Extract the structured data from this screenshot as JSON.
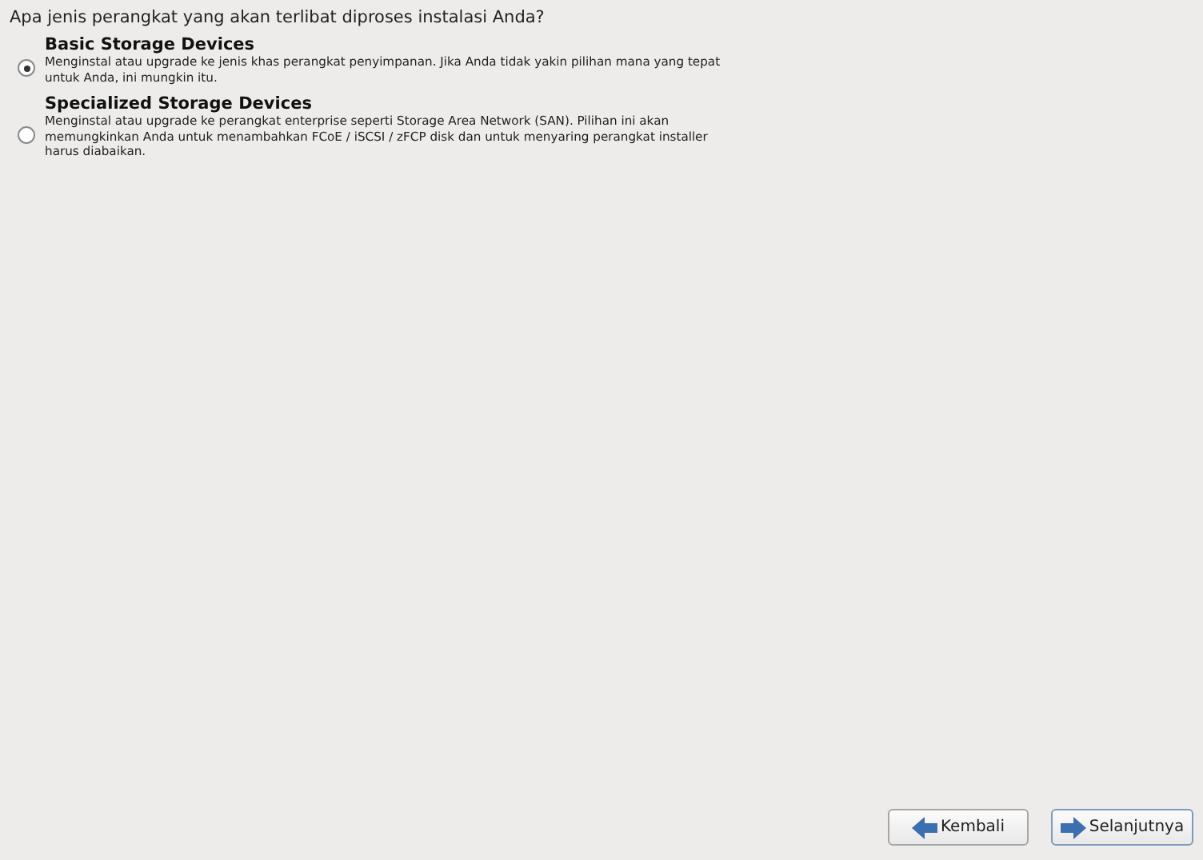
{
  "question": "Apa jenis perangkat yang akan terlibat diproses instalasi Anda?",
  "options": [
    {
      "title": "Basic Storage Devices",
      "description": "Menginstal atau upgrade ke jenis khas perangkat penyimpanan. Jika Anda tidak yakin pilihan mana yang tepat untuk Anda, ini mungkin itu.",
      "selected": true
    },
    {
      "title": "Specialized Storage Devices",
      "description": "Menginstal atau upgrade ke perangkat enterprise seperti Storage Area Network (SAN). Pilihan ini akan memungkinkan Anda untuk menambahkan FCoE / iSCSI / zFCP disk dan untuk menyaring perangkat installer harus diabaikan.",
      "selected": false
    }
  ],
  "buttons": [
    {
      "kind": "back",
      "label": "Kembali",
      "focused": false
    },
    {
      "kind": "next",
      "label": "Selanjutnya",
      "focused": true
    }
  ]
}
